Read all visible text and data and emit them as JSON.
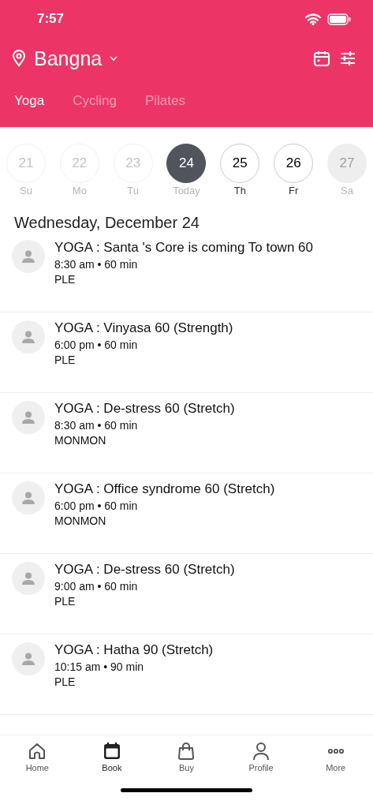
{
  "status_bar": {
    "time": "7:57"
  },
  "header": {
    "location": "Bangna"
  },
  "tabs": [
    {
      "label": "Yoga",
      "selected": true
    },
    {
      "label": "Cycling",
      "selected": false
    },
    {
      "label": "Pilates",
      "selected": false
    }
  ],
  "days": [
    {
      "date": "21",
      "label": "Su",
      "kind": "past",
      "selected": false
    },
    {
      "date": "22",
      "label": "Mo",
      "kind": "past",
      "selected": false
    },
    {
      "date": "23",
      "label": "Tu",
      "kind": "past",
      "selected": false
    },
    {
      "date": "24",
      "label": "Today",
      "kind": "open",
      "selected": true
    },
    {
      "date": "25",
      "label": "Th",
      "kind": "open",
      "selected": false
    },
    {
      "date": "26",
      "label": "Fr",
      "kind": "open",
      "selected": false
    },
    {
      "date": "27",
      "label": "Sa",
      "kind": "closed",
      "selected": false
    }
  ],
  "day_heading": "Wednesday, December 24",
  "classes": [
    {
      "title": "YOGA : Santa 's Core is coming To town 60",
      "time": "8:30 am • 60 min",
      "instructor": "PLE"
    },
    {
      "title": "YOGA : Vinyasa 60 (Strength)",
      "time": "6:00 pm • 60 min",
      "instructor": "PLE"
    },
    {
      "title": "YOGA : De-stress 60 (Stretch)",
      "time": "8:30 am • 60 min",
      "instructor": "MONMON"
    },
    {
      "title": "YOGA : Office syndrome 60 (Stretch)",
      "time": "6:00 pm • 60 min",
      "instructor": "MONMON"
    },
    {
      "title": "YOGA : De-stress 60 (Stretch)",
      "time": "9:00 am • 60 min",
      "instructor": "PLE"
    },
    {
      "title": "YOGA : Hatha 90 (Stretch)",
      "time": "10:15 am • 90 min",
      "instructor": "PLE"
    }
  ],
  "nav": [
    {
      "label": "Home",
      "kind": "home",
      "selected": false
    },
    {
      "label": "Book",
      "kind": "book",
      "selected": true
    },
    {
      "label": "Buy",
      "kind": "buy",
      "selected": false
    },
    {
      "label": "Profile",
      "kind": "profile",
      "selected": false
    },
    {
      "label": "More",
      "kind": "more",
      "selected": false
    }
  ]
}
